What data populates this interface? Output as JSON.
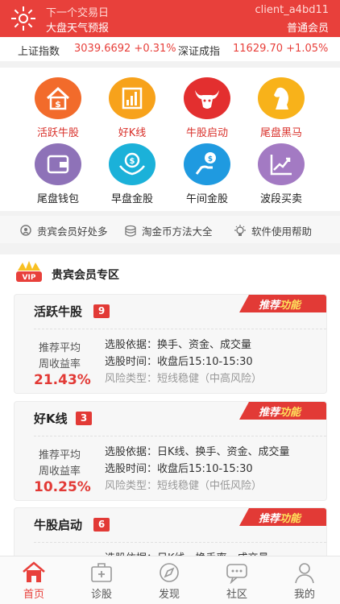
{
  "header": {
    "line1_left": "下一个交易日",
    "line2_left": "大盘天气预报",
    "client_id": "client_a4bd11",
    "member_level": "普通会员"
  },
  "indices": [
    {
      "name": "上证指数",
      "value": "3039.6692 +0.31%"
    },
    {
      "name": "深证成指",
      "value": "11629.70 +1.05%"
    }
  ],
  "features": [
    {
      "label": "活跃牛股",
      "icon": "house-dollar-icon",
      "color": "#f26b2b",
      "label_color": "#d9312b"
    },
    {
      "label": "好K线",
      "icon": "bar-chart-icon",
      "color": "#f7a21b",
      "label_color": "#d9312b"
    },
    {
      "label": "牛股启动",
      "icon": "bull-icon",
      "color": "#e32f2f",
      "label_color": "#d9312b"
    },
    {
      "label": "尾盘黑马",
      "icon": "chess-knight-icon",
      "color": "#f8b21a",
      "label_color": "#d9312b"
    },
    {
      "label": "尾盘钱包",
      "icon": "wallet-icon",
      "color": "#8e72b8",
      "label_color": "#222222"
    },
    {
      "label": "早盘金股",
      "icon": "hands-coin-icon",
      "color": "#1bb1d9",
      "label_color": "#222222"
    },
    {
      "label": "午间金股",
      "icon": "hand-coin-icon",
      "color": "#1f9ae0",
      "label_color": "#222222"
    },
    {
      "label": "波段买卖",
      "icon": "growth-chart-icon",
      "color": "#a37ac3",
      "label_color": "#222222"
    }
  ],
  "links": [
    {
      "label": "贵宾会员好处多",
      "icon": "user-pin-icon"
    },
    {
      "label": "淘金币方法大全",
      "icon": "coin-stack-icon"
    },
    {
      "label": "软件使用帮助",
      "icon": "lightbulb-icon"
    }
  ],
  "vip": {
    "badge": "VIP",
    "title": "贵宾会员专区",
    "ribbon_part1": "推荐",
    "ribbon_part2": "功能",
    "cards": [
      {
        "name": "活跃牛股",
        "count": "9",
        "return_label_1": "推荐平均",
        "return_label_2": "周收益率",
        "return": "21.43%",
        "basis": "选股依据：换手、资金、成交量",
        "time": "选股时间：收盘后15:10-15:30",
        "risk": "风险类型：短线稳健（中高风险）"
      },
      {
        "name": "好K线",
        "count": "3",
        "return_label_1": "推荐平均",
        "return_label_2": "周收益率",
        "return": "10.25%",
        "basis": "选股依据：日K线、换手、资金、成交量",
        "time": "选股时间：收盘后15:10-15:30",
        "risk": "风险类型：短线稳健（中低风险）"
      },
      {
        "name": "牛股启动",
        "count": "6",
        "basis": "选股依据：日K线、换手率、成交量"
      }
    ]
  },
  "tabs": [
    {
      "label": "首页",
      "icon": "home-icon",
      "active": true
    },
    {
      "label": "诊股",
      "icon": "medical-kit-icon",
      "active": false
    },
    {
      "label": "发现",
      "icon": "compass-icon",
      "active": false
    },
    {
      "label": "社区",
      "icon": "chat-bubble-icon",
      "active": false
    },
    {
      "label": "我的",
      "icon": "user-icon",
      "active": false
    }
  ]
}
